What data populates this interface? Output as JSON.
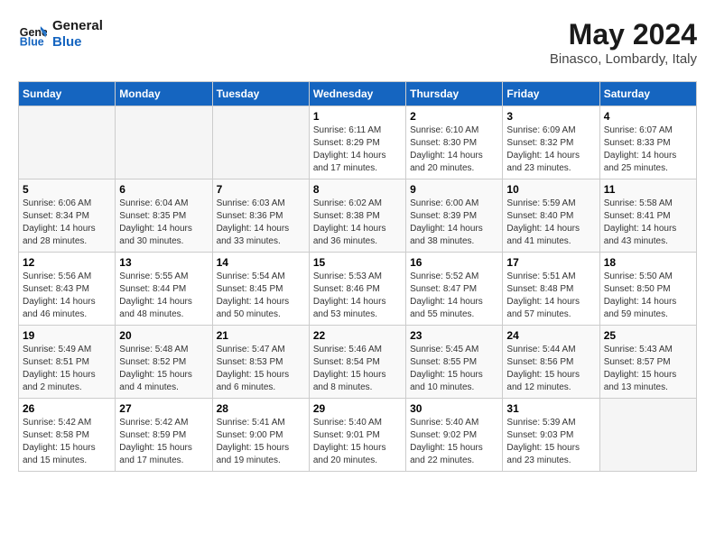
{
  "header": {
    "logo_line1": "General",
    "logo_line2": "Blue",
    "month": "May 2024",
    "location": "Binasco, Lombardy, Italy"
  },
  "weekdays": [
    "Sunday",
    "Monday",
    "Tuesday",
    "Wednesday",
    "Thursday",
    "Friday",
    "Saturday"
  ],
  "weeks": [
    [
      {
        "day": "",
        "info": ""
      },
      {
        "day": "",
        "info": ""
      },
      {
        "day": "",
        "info": ""
      },
      {
        "day": "1",
        "info": "Sunrise: 6:11 AM\nSunset: 8:29 PM\nDaylight: 14 hours\nand 17 minutes."
      },
      {
        "day": "2",
        "info": "Sunrise: 6:10 AM\nSunset: 8:30 PM\nDaylight: 14 hours\nand 20 minutes."
      },
      {
        "day": "3",
        "info": "Sunrise: 6:09 AM\nSunset: 8:32 PM\nDaylight: 14 hours\nand 23 minutes."
      },
      {
        "day": "4",
        "info": "Sunrise: 6:07 AM\nSunset: 8:33 PM\nDaylight: 14 hours\nand 25 minutes."
      }
    ],
    [
      {
        "day": "5",
        "info": "Sunrise: 6:06 AM\nSunset: 8:34 PM\nDaylight: 14 hours\nand 28 minutes."
      },
      {
        "day": "6",
        "info": "Sunrise: 6:04 AM\nSunset: 8:35 PM\nDaylight: 14 hours\nand 30 minutes."
      },
      {
        "day": "7",
        "info": "Sunrise: 6:03 AM\nSunset: 8:36 PM\nDaylight: 14 hours\nand 33 minutes."
      },
      {
        "day": "8",
        "info": "Sunrise: 6:02 AM\nSunset: 8:38 PM\nDaylight: 14 hours\nand 36 minutes."
      },
      {
        "day": "9",
        "info": "Sunrise: 6:00 AM\nSunset: 8:39 PM\nDaylight: 14 hours\nand 38 minutes."
      },
      {
        "day": "10",
        "info": "Sunrise: 5:59 AM\nSunset: 8:40 PM\nDaylight: 14 hours\nand 41 minutes."
      },
      {
        "day": "11",
        "info": "Sunrise: 5:58 AM\nSunset: 8:41 PM\nDaylight: 14 hours\nand 43 minutes."
      }
    ],
    [
      {
        "day": "12",
        "info": "Sunrise: 5:56 AM\nSunset: 8:43 PM\nDaylight: 14 hours\nand 46 minutes."
      },
      {
        "day": "13",
        "info": "Sunrise: 5:55 AM\nSunset: 8:44 PM\nDaylight: 14 hours\nand 48 minutes."
      },
      {
        "day": "14",
        "info": "Sunrise: 5:54 AM\nSunset: 8:45 PM\nDaylight: 14 hours\nand 50 minutes."
      },
      {
        "day": "15",
        "info": "Sunrise: 5:53 AM\nSunset: 8:46 PM\nDaylight: 14 hours\nand 53 minutes."
      },
      {
        "day": "16",
        "info": "Sunrise: 5:52 AM\nSunset: 8:47 PM\nDaylight: 14 hours\nand 55 minutes."
      },
      {
        "day": "17",
        "info": "Sunrise: 5:51 AM\nSunset: 8:48 PM\nDaylight: 14 hours\nand 57 minutes."
      },
      {
        "day": "18",
        "info": "Sunrise: 5:50 AM\nSunset: 8:50 PM\nDaylight: 14 hours\nand 59 minutes."
      }
    ],
    [
      {
        "day": "19",
        "info": "Sunrise: 5:49 AM\nSunset: 8:51 PM\nDaylight: 15 hours\nand 2 minutes."
      },
      {
        "day": "20",
        "info": "Sunrise: 5:48 AM\nSunset: 8:52 PM\nDaylight: 15 hours\nand 4 minutes."
      },
      {
        "day": "21",
        "info": "Sunrise: 5:47 AM\nSunset: 8:53 PM\nDaylight: 15 hours\nand 6 minutes."
      },
      {
        "day": "22",
        "info": "Sunrise: 5:46 AM\nSunset: 8:54 PM\nDaylight: 15 hours\nand 8 minutes."
      },
      {
        "day": "23",
        "info": "Sunrise: 5:45 AM\nSunset: 8:55 PM\nDaylight: 15 hours\nand 10 minutes."
      },
      {
        "day": "24",
        "info": "Sunrise: 5:44 AM\nSunset: 8:56 PM\nDaylight: 15 hours\nand 12 minutes."
      },
      {
        "day": "25",
        "info": "Sunrise: 5:43 AM\nSunset: 8:57 PM\nDaylight: 15 hours\nand 13 minutes."
      }
    ],
    [
      {
        "day": "26",
        "info": "Sunrise: 5:42 AM\nSunset: 8:58 PM\nDaylight: 15 hours\nand 15 minutes."
      },
      {
        "day": "27",
        "info": "Sunrise: 5:42 AM\nSunset: 8:59 PM\nDaylight: 15 hours\nand 17 minutes."
      },
      {
        "day": "28",
        "info": "Sunrise: 5:41 AM\nSunset: 9:00 PM\nDaylight: 15 hours\nand 19 minutes."
      },
      {
        "day": "29",
        "info": "Sunrise: 5:40 AM\nSunset: 9:01 PM\nDaylight: 15 hours\nand 20 minutes."
      },
      {
        "day": "30",
        "info": "Sunrise: 5:40 AM\nSunset: 9:02 PM\nDaylight: 15 hours\nand 22 minutes."
      },
      {
        "day": "31",
        "info": "Sunrise: 5:39 AM\nSunset: 9:03 PM\nDaylight: 15 hours\nand 23 minutes."
      },
      {
        "day": "",
        "info": ""
      }
    ]
  ],
  "colors": {
    "header_bg": "#1565c0",
    "logo_blue": "#1565c0"
  }
}
